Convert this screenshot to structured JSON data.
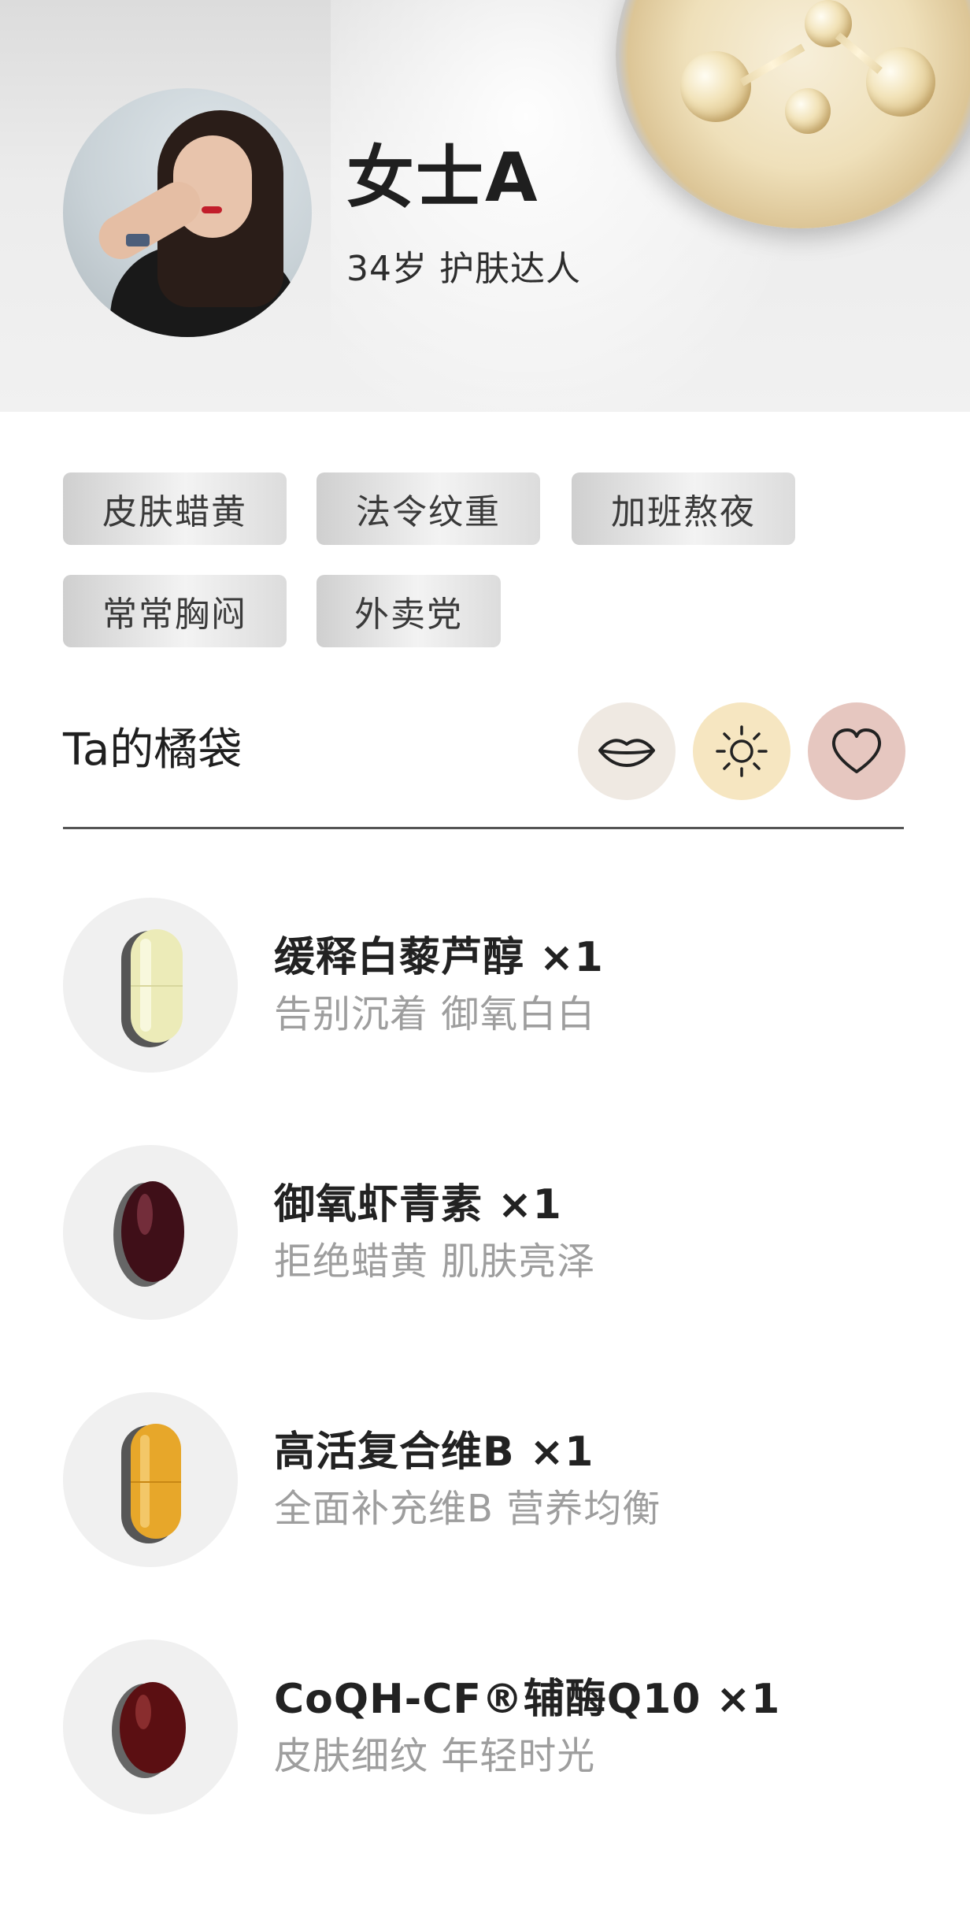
{
  "profile": {
    "name": "女士A",
    "subtitle": "34岁 护肤达人"
  },
  "tags": [
    "皮肤蜡黄",
    "法令纹重",
    "加班熬夜",
    "常常胸闷",
    "外卖党"
  ],
  "section": {
    "title": "Ta的橘袋",
    "icons": [
      {
        "name": "lips-icon",
        "bg": "#efe9e2"
      },
      {
        "name": "sun-icon",
        "bg": "#f6e6c1"
      },
      {
        "name": "heart-icon",
        "bg": "#e6c7c0"
      }
    ]
  },
  "products": [
    {
      "title": "缓释白藜芦醇 ×1",
      "desc": "告别沉着 御氧白白",
      "pill": "capsule-cream-icon",
      "color": "#ecebb8"
    },
    {
      "title": "御氧虾青素 ×1",
      "desc": "拒绝蜡黄 肌肤亮泽",
      "pill": "softgel-darkred-icon",
      "color": "#3f0f18"
    },
    {
      "title": "高活复合维B ×1",
      "desc": "全面补充维B 营养均衡",
      "pill": "capsule-orange-icon",
      "color": "#e7a72a"
    },
    {
      "title": "CoQH-CF®辅酶Q10 ×1",
      "desc": "皮肤细纹 年轻时光",
      "pill": "softgel-red-icon",
      "color": "#5b0f12"
    }
  ]
}
